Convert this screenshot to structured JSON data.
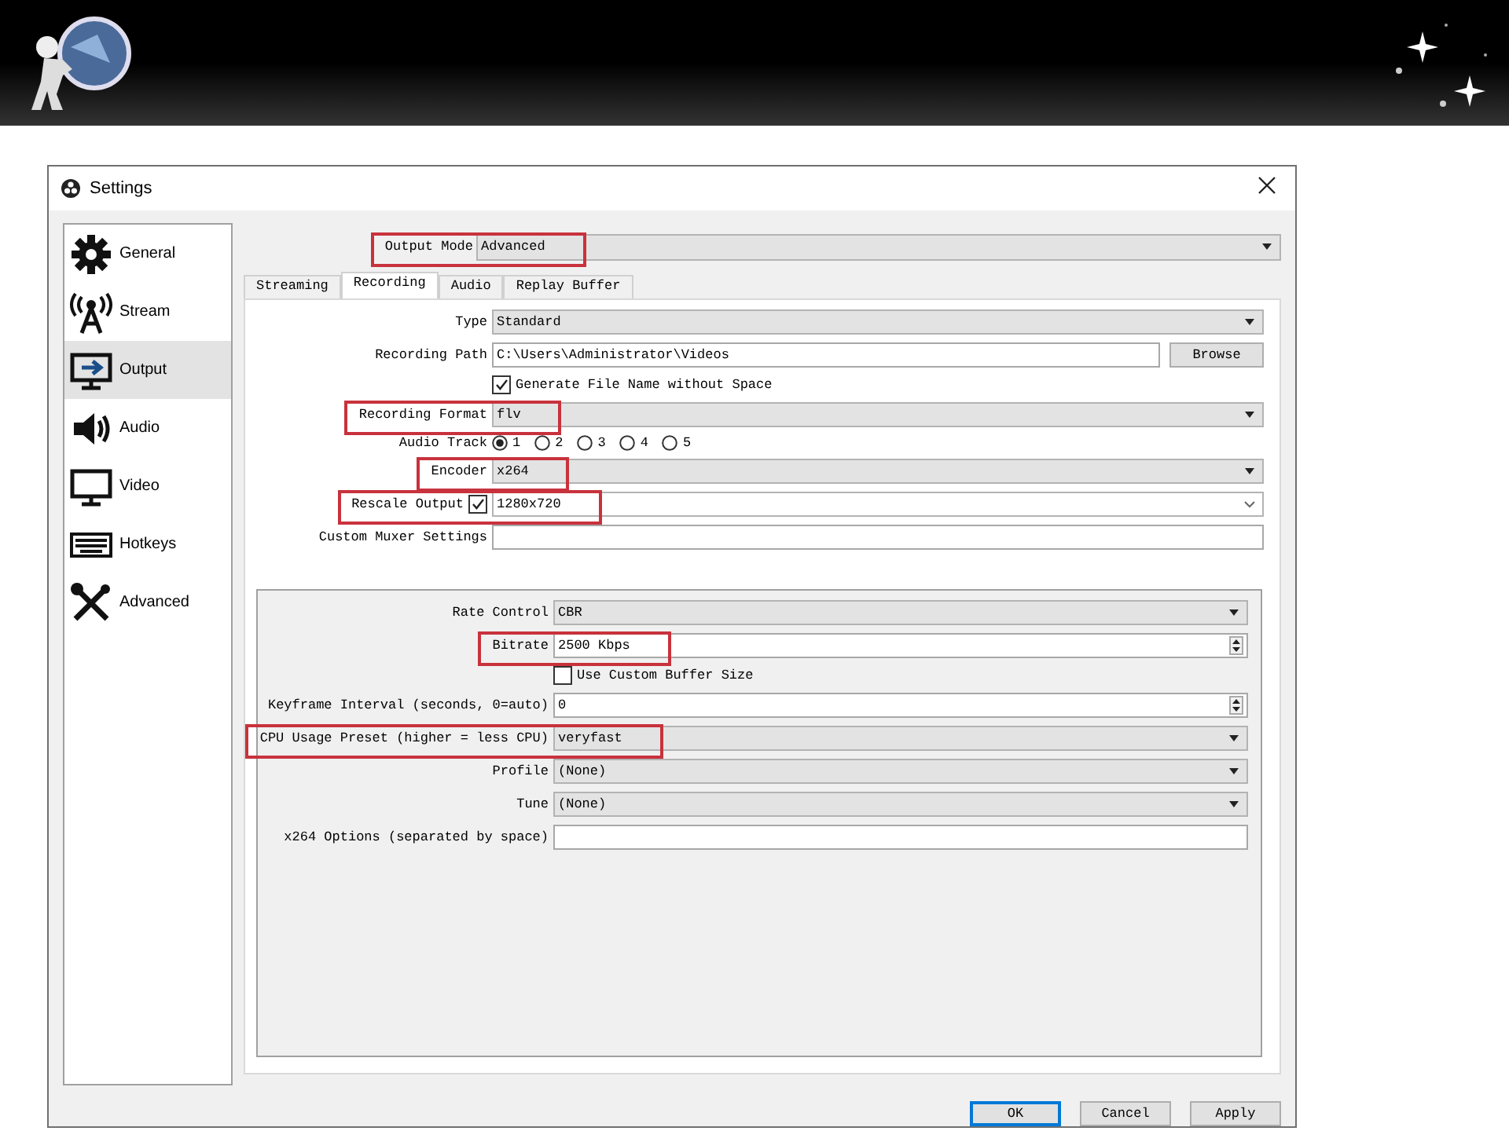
{
  "window": {
    "title": "Settings"
  },
  "sidebar": {
    "items": [
      {
        "label": "General",
        "selected": false
      },
      {
        "label": "Stream",
        "selected": false
      },
      {
        "label": "Output",
        "selected": true
      },
      {
        "label": "Audio",
        "selected": false
      },
      {
        "label": "Video",
        "selected": false
      },
      {
        "label": "Hotkeys",
        "selected": false
      },
      {
        "label": "Advanced",
        "selected": false
      }
    ]
  },
  "output_mode": {
    "label": "Output Mode",
    "value": "Advanced",
    "highlighted": true
  },
  "tabs": [
    {
      "label": "Streaming",
      "selected": false
    },
    {
      "label": "Recording",
      "selected": true
    },
    {
      "label": "Audio",
      "selected": false
    },
    {
      "label": "Replay Buffer",
      "selected": false
    }
  ],
  "recording_fields": [
    {
      "kind": "combo",
      "label": "Type",
      "value": "Standard"
    },
    {
      "kind": "path",
      "label": "Recording Path",
      "value": "C:\\Users\\Administrator\\Videos",
      "button": "Browse"
    },
    {
      "kind": "checkbox",
      "label": "Generate File Name without Space",
      "checked": true
    },
    {
      "kind": "combo",
      "label": "Recording Format",
      "value": "flv",
      "highlighted": true
    },
    {
      "kind": "radio",
      "label": "Audio Track",
      "options": [
        {
          "label": "1",
          "selected": true
        },
        {
          "label": "2",
          "selected": false
        },
        {
          "label": "3",
          "selected": false
        },
        {
          "label": "4",
          "selected": false
        },
        {
          "label": "5",
          "selected": false
        }
      ]
    },
    {
      "kind": "combo",
      "label": "Encoder",
      "value": "x264",
      "highlighted": true
    },
    {
      "kind": "checked_combo",
      "label": "Rescale Output",
      "checked": true,
      "value": "1280x720",
      "highlighted": true
    },
    {
      "kind": "input",
      "label": "Custom Muxer Settings"
    }
  ],
  "encoder_settings": [
    {
      "kind": "combo",
      "label": "Rate Control",
      "value": "CBR"
    },
    {
      "kind": "spin",
      "label": "Bitrate",
      "value": "2500 Kbps",
      "highlighted": true
    },
    {
      "kind": "checkbox",
      "label": "Use Custom Buffer Size",
      "checked": false
    },
    {
      "kind": "spin",
      "label": "Keyframe Interval (seconds, 0=auto)",
      "value": "0"
    },
    {
      "kind": "combo",
      "label": "CPU Usage Preset (higher = less CPU)",
      "value": "veryfast",
      "highlighted": true
    },
    {
      "kind": "combo",
      "label": "Profile",
      "value": "(None)"
    },
    {
      "kind": "combo",
      "label": "Tune",
      "value": "(None)"
    },
    {
      "kind": "input",
      "label": "x264 Options (separated by space)"
    }
  ],
  "buttons": [
    {
      "label": "OK",
      "default": true
    },
    {
      "label": "Cancel",
      "default": false
    },
    {
      "label": "Apply",
      "default": false
    }
  ]
}
